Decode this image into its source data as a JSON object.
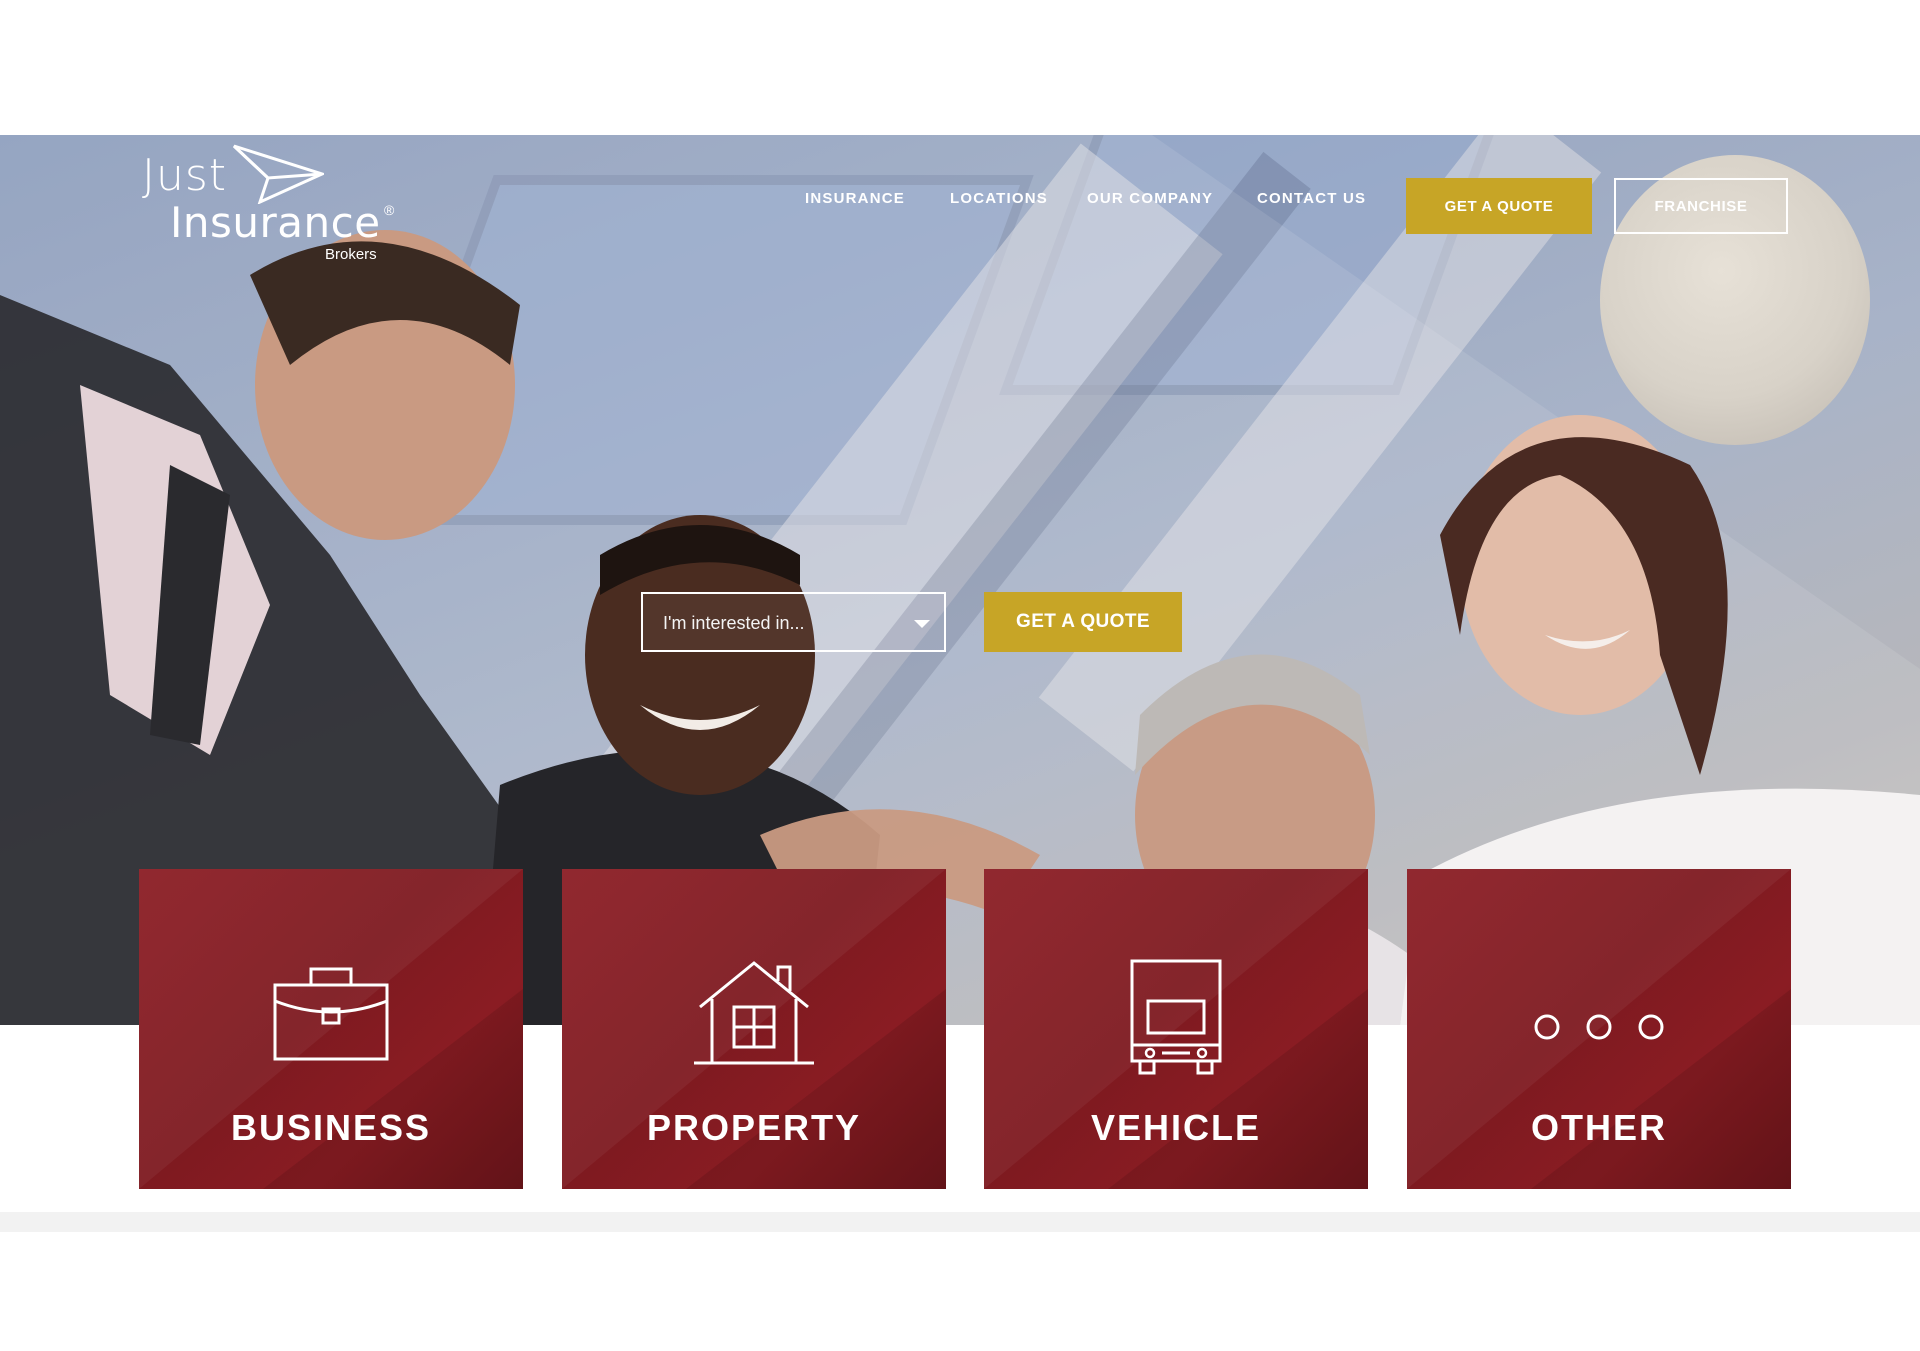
{
  "brand": {
    "logo_word1": "Just",
    "logo_word2": "Insurance",
    "logo_sub": "Brokers",
    "logo_mark": "®"
  },
  "nav": {
    "items": [
      {
        "label": "INSURANCE"
      },
      {
        "label": "LOCATIONS"
      },
      {
        "label": "OUR COMPANY"
      },
      {
        "label": "CONTACT US"
      }
    ],
    "get_quote_label": "GET A QUOTE",
    "franchise_label": "FRANCHISE"
  },
  "hero": {
    "select_placeholder": "I'm interested in...",
    "get_quote_label": "GET A QUOTE"
  },
  "categories": [
    {
      "label": "BUSINESS",
      "icon": "briefcase-icon"
    },
    {
      "label": "PROPERTY",
      "icon": "house-icon"
    },
    {
      "label": "VEHICLE",
      "icon": "truck-icon"
    },
    {
      "label": "OTHER",
      "icon": "more-dots-icon"
    }
  ],
  "colors": {
    "accent_gold": "#c7a526",
    "card_red": "#8c1d24",
    "text_white": "#ffffff"
  }
}
